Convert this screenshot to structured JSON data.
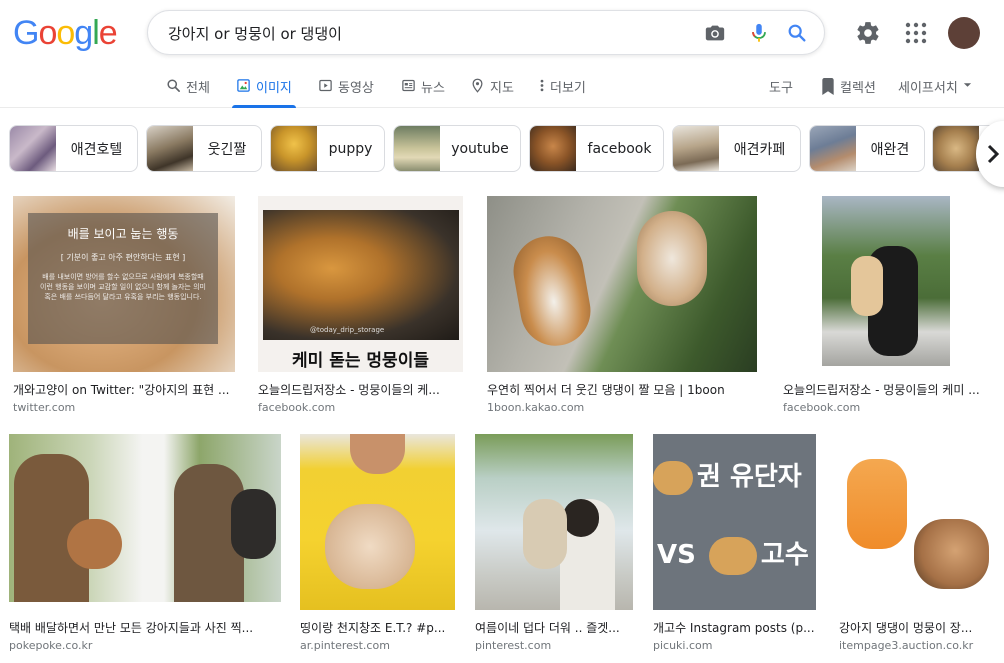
{
  "logo": {
    "letters": [
      "G",
      "o",
      "o",
      "g",
      "l",
      "e"
    ],
    "colors": [
      "#4285F4",
      "#EA4335",
      "#FBBC05",
      "#4285F4",
      "#34A853",
      "#EA4335"
    ]
  },
  "search": {
    "query": "강아지 or 멍뭉이 or 댕댕이",
    "camera_icon": "camera-icon",
    "mic_icon": "microphone-icon",
    "search_icon": "search-icon"
  },
  "header": {
    "settings_icon": "gear-icon",
    "apps_icon": "apps-grid-icon",
    "avatar_color": "#5d4037"
  },
  "tabs": [
    {
      "label": "전체",
      "icon": "search-icon"
    },
    {
      "label": "이미지",
      "icon": "image-icon",
      "active": true
    },
    {
      "label": "동영상",
      "icon": "play-icon"
    },
    {
      "label": "뉴스",
      "icon": "news-icon"
    },
    {
      "label": "지도",
      "icon": "map-pin-icon"
    },
    {
      "label": "더보기",
      "icon": "more-vert-icon"
    }
  ],
  "tools": {
    "tools_label": "도구",
    "collections_label": "컬렉션",
    "safesearch_label": "세이프서치"
  },
  "chips": [
    {
      "label": "애견호텔"
    },
    {
      "label": "웃긴짤"
    },
    {
      "label": "puppy"
    },
    {
      "label": "youtube"
    },
    {
      "label": "facebook"
    },
    {
      "label": "애견카페"
    },
    {
      "label": "애완견"
    }
  ],
  "results": [
    {
      "title": "개와고양이 on Twitter: \"강아지의 표현 ...",
      "site": "twitter.com",
      "overlay_title": "배를 보이고 눕는 행동",
      "overlay_sub": "[ 기분이 좋고 아주 편안하다는 표현 ]",
      "overlay_body": "배를 내보이면 방어를 할수 없으므로 사람에게 복종할때 이런 행동을 보이며 교감할 일이 없으니 함께 놀자는 의미 혹은 배를 쓰다듬어 달라고 유혹을 부리는 행동입니다."
    },
    {
      "title": "오늘의드립저장소 - 멍뭉이들의 케...",
      "site": "facebook.com",
      "overlay_title": "케미 돋는 멍뭉이들",
      "overlay_sub": "@today_drip_storage"
    },
    {
      "title": "우연히 찍어서 더 웃긴 댕댕이 짤 모음 | 1boon",
      "site": "1boon.kakao.com"
    },
    {
      "title": "오늘의드립저장소 - 멍뭉이들의 케미 ...",
      "site": "facebook.com"
    },
    {
      "title": "택배 배달하면서 만난 모든 강아지들과 사진 찍...",
      "site": "pokepoke.co.kr"
    },
    {
      "title": "띵이랑 천지창조 E.T.? #p...",
      "site": "ar.pinterest.com"
    },
    {
      "title": "여름이네 덥다 더워 .. 즐겟...",
      "site": "pinterest.com"
    },
    {
      "title": "개고수 Instagram posts (p...",
      "site": "picuki.com",
      "overlay_line1": "권 유단자",
      "overlay_line2": "VS",
      "overlay_line3": "고수"
    },
    {
      "title": "강아지 댕댕이 멍뭉이 장...",
      "site": "itempage3.auction.co.kr"
    }
  ]
}
